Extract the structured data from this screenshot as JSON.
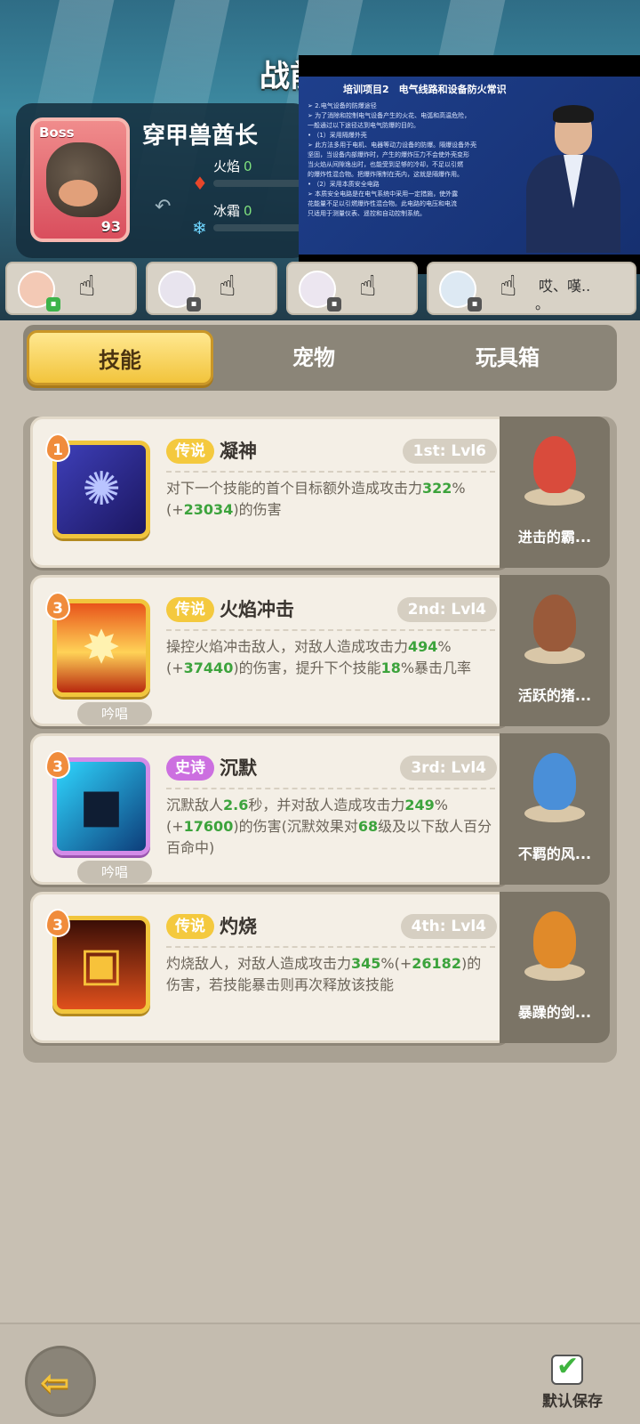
{
  "scene": {
    "title": "战前",
    "boss": {
      "badge": "Boss",
      "name": "穿甲兽酋长",
      "level": "93",
      "fire_label": "火焰",
      "fire_value": "0",
      "frost_label": "冰霜",
      "frost_value": "0"
    },
    "team_speech": "哎、嘆..",
    "team_speech_2": "。"
  },
  "video": {
    "title": "培训项目2　电气线路和设备防火常识",
    "lines": [
      "➢ 2.电气设备的防爆途径",
      "➢ 为了消除和控制电气设备产生的火花、电弧和高温危险，",
      "一般通过以下途径达到电气防爆的目的。",
      "• （1）采用隔爆外壳",
      "➢ 此方法多用于电机、电器等动力设备的防爆。隔爆设备外壳",
      "坚固，当设备内部爆炸时，产生的爆炸压力不会使外壳变形",
      "当火焰从间隙逸出时，也能受到足够的冷却，不足以引燃",
      "的爆炸性混合物。把爆炸限制在壳内，这就是隔爆作用。",
      "• （2）采用本质安全电路",
      "➢ 本质安全电路是在电气系统中采用一定措施，使外露",
      "花能量不足以引燃爆炸性混合物。此电路的电压和电流",
      "只适用于测量仪表、遥控和自动控制系统。"
    ]
  },
  "tabs": [
    "技能",
    "宠物",
    "玩具箱"
  ],
  "skills": [
    {
      "slot": "1",
      "rarity": "传说",
      "name": "凝神",
      "level": "1st: Lvl6",
      "desc_parts": [
        "对下一个技能的首个目标额外造成攻击力",
        "322",
        "%(+",
        "23034",
        ")的伤害"
      ],
      "chant": "",
      "pet_name": "进击的霸..."
    },
    {
      "slot": "3",
      "rarity": "传说",
      "name": "火焰冲击",
      "level": "2nd: Lvl4",
      "desc_parts": [
        "操控火焰冲击敌人，对敌人造成攻击力",
        "494",
        "%(+",
        "37440",
        ")的伤害，提升下个技能",
        "18",
        "%暴击几率"
      ],
      "chant": "吟唱",
      "pet_name": "活跃的猪..."
    },
    {
      "slot": "3",
      "rarity": "史诗",
      "name": "沉默",
      "level": "3rd: Lvl4",
      "desc_parts": [
        "沉默敌人",
        "2.6",
        "秒，并对敌人造成攻击力",
        "249",
        "%(+",
        "17600",
        ")的伤害(沉默效果对",
        "68",
        "级及以下敌人百分百命中)"
      ],
      "chant": "吟唱",
      "pet_name": "不羁的风..."
    },
    {
      "slot": "3",
      "rarity": "传说",
      "name": "灼烧",
      "level": "4th: Lvl4",
      "desc_parts": [
        "灼烧敌人，对敌人造成攻击力",
        "345",
        "%(+",
        "26182",
        ")的伤害，若技能暴击则再次释放该技能"
      ],
      "chant": "",
      "pet_name": "暴躁的剑..."
    }
  ],
  "bottom": {
    "save_label": "默认保存"
  },
  "colors": {
    "legend": "#f4c93e",
    "epic": "#cc6fe0",
    "highlight": "#3ca33c",
    "tab_active": "#f2c43c"
  }
}
